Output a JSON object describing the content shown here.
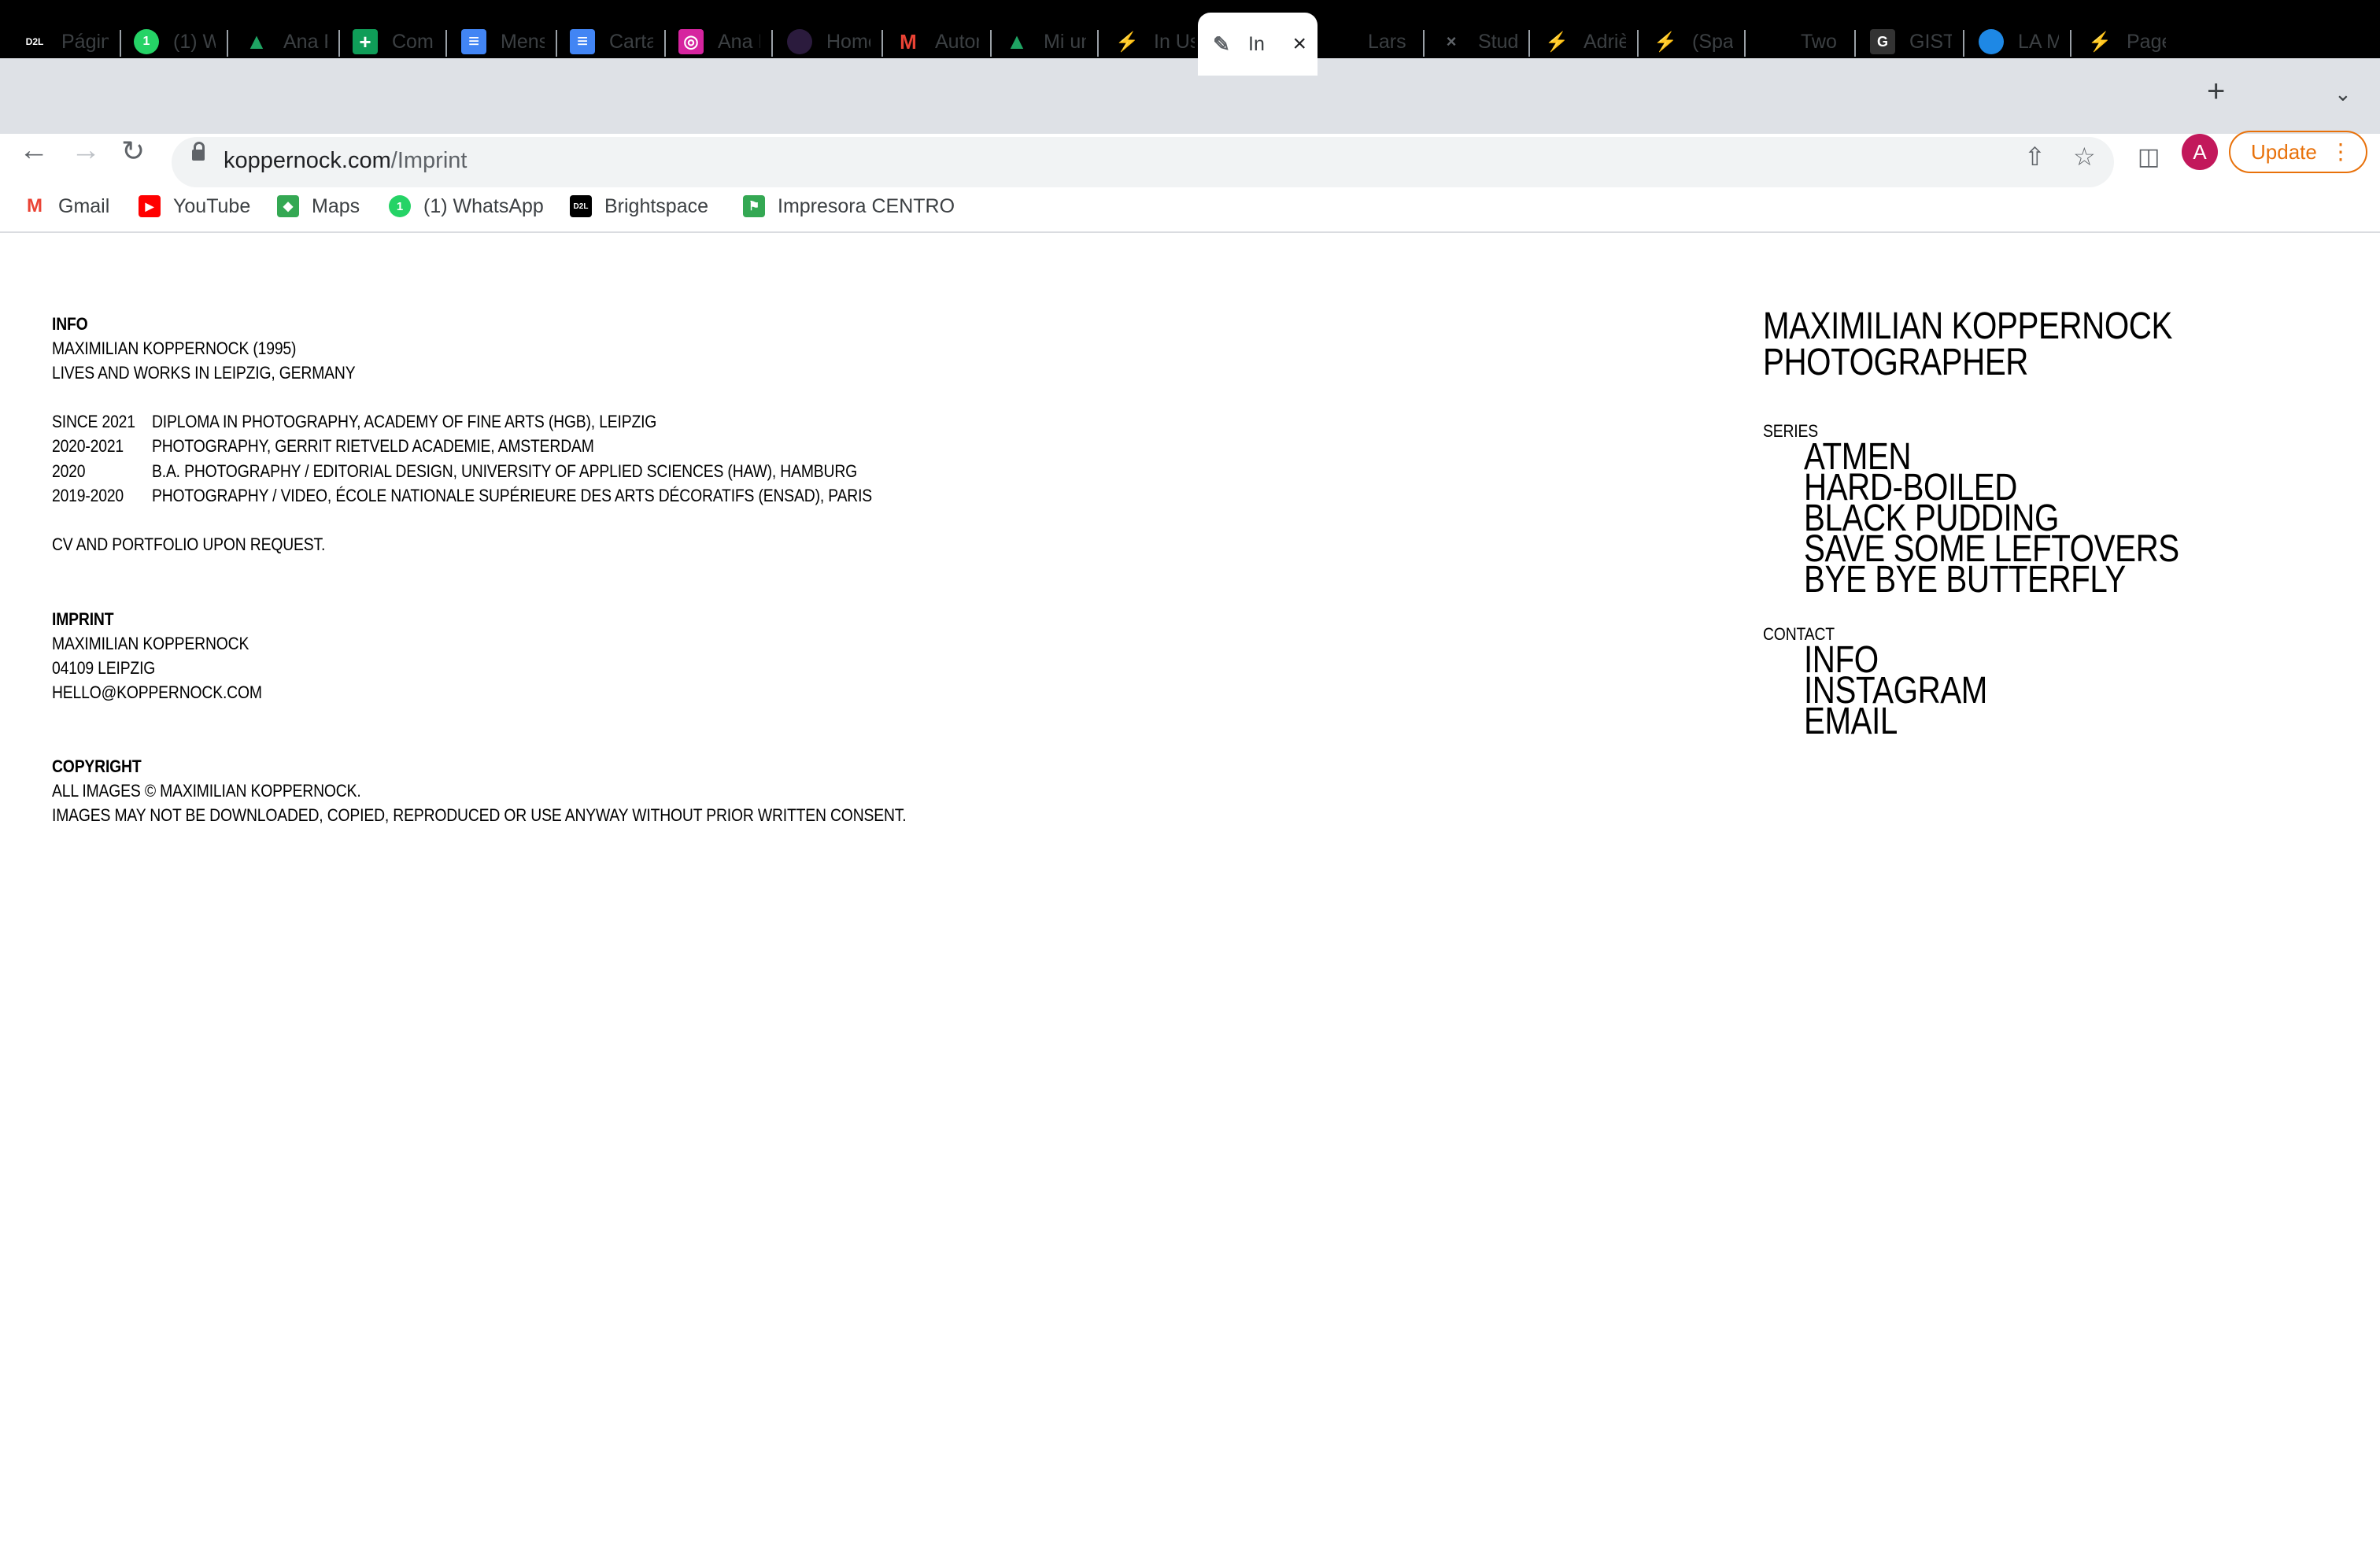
{
  "browser": {
    "tabs": [
      {
        "title": "Págin",
        "icon": "d2l-icon"
      },
      {
        "title": "(1) W",
        "icon": "whatsapp-icon"
      },
      {
        "title": "Ana F",
        "icon": "google-drive-icon"
      },
      {
        "title": "Comp",
        "icon": "google-sheets-icon"
      },
      {
        "title": "Mens",
        "icon": "google-docs-icon"
      },
      {
        "title": "Carta",
        "icon": "google-docs-icon"
      },
      {
        "title": "Ana E",
        "icon": "instagram-icon"
      },
      {
        "title": "Home",
        "icon": "dark-circle-icon"
      },
      {
        "title": "Autor",
        "icon": "gmail-icon"
      },
      {
        "title": "Mi un",
        "icon": "google-drive-icon"
      },
      {
        "title": "In Us",
        "icon": "bolt-icon"
      },
      {
        "title": "In",
        "icon": "bird-sketch-icon",
        "active": true
      },
      {
        "title": "Lars",
        "icon": "black-circle-icon"
      },
      {
        "title": "Studi",
        "icon": "x-icon"
      },
      {
        "title": "Adriè",
        "icon": "bolt-icon"
      },
      {
        "title": "(Spar",
        "icon": "bolt-icon"
      },
      {
        "title": "Two F",
        "icon": "j-icon"
      },
      {
        "title": "GIST",
        "icon": "gist-icon"
      },
      {
        "title": "LA M",
        "icon": "globe-icon"
      },
      {
        "title": "Page",
        "icon": "bolt-icon"
      }
    ],
    "url_domain": "koppernock.com",
    "url_path": "/Imprint",
    "profile_initial": "A",
    "update_label": "Update",
    "bookmarks": [
      {
        "label": "Gmail",
        "icon": "gmail-icon"
      },
      {
        "label": "YouTube",
        "icon": "youtube-icon"
      },
      {
        "label": "Maps",
        "icon": "maps-icon"
      },
      {
        "label": "(1) WhatsApp",
        "icon": "whatsapp-icon"
      },
      {
        "label": "Brightspace",
        "icon": "d2l-icon"
      },
      {
        "label": "Impresora CENTRO",
        "icon": "flag-icon"
      }
    ]
  },
  "page": {
    "info": {
      "heading": "INFO",
      "name_line": "MAXIMILIAN KOPPERNOCK (1995)",
      "location_line": "LIVES AND WORKS IN LEIPZIG, GERMANY",
      "education": [
        {
          "years": "SINCE 2021",
          "desc": "DIPLOMA IN PHOTOGRAPHY, ACADEMY OF FINE ARTS (HGB), LEIPZIG"
        },
        {
          "years": "2020-2021",
          "desc": "PHOTOGRAPHY, GERRIT RIETVELD ACADEMIE, AMSTERDAM"
        },
        {
          "years": "2020",
          "desc": "B.A. PHOTOGRAPHY / EDITORIAL DESIGN, UNIVERSITY OF APPLIED SCIENCES (HAW), HAMBURG"
        },
        {
          "years": "2019-2020",
          "desc": "PHOTOGRAPHY / VIDEO, ÉCOLE NATIONALE SUPÉRIEURE DES ARTS DÉCORATIFS (ENSAD), PARIS"
        }
      ],
      "cv_note": "CV AND PORTFOLIO UPON REQUEST."
    },
    "imprint": {
      "heading": "IMPRINT",
      "lines": [
        "MAXIMILIAN KOPPERNOCK",
        "04109 LEIPZIG",
        "HELLO@KOPPERNOCK.COM"
      ]
    },
    "copyright": {
      "heading": "COPYRIGHT",
      "lines": [
        "ALL IMAGES © MAXIMILIAN KOPPERNOCK.",
        "IMAGES MAY NOT BE DOWNLOADED, COPIED, REPRODUCED OR USE ANYWAY WITHOUT PRIOR WRITTEN CONSENT."
      ]
    },
    "side": {
      "title_line1": "MAXIMILIAN KOPPERNOCK",
      "title_line2": "PHOTOGRAPHER",
      "series_label": "SERIES",
      "series": [
        "ATMEN",
        "HARD-BOILED",
        "BLACK PUDDING",
        "SAVE SOME LEFTOVERS",
        "BYE BYE BUTTERFLY"
      ],
      "contact_label": "CONTACT",
      "contact": [
        "INFO",
        "INSTAGRAM",
        "EMAIL"
      ]
    }
  }
}
